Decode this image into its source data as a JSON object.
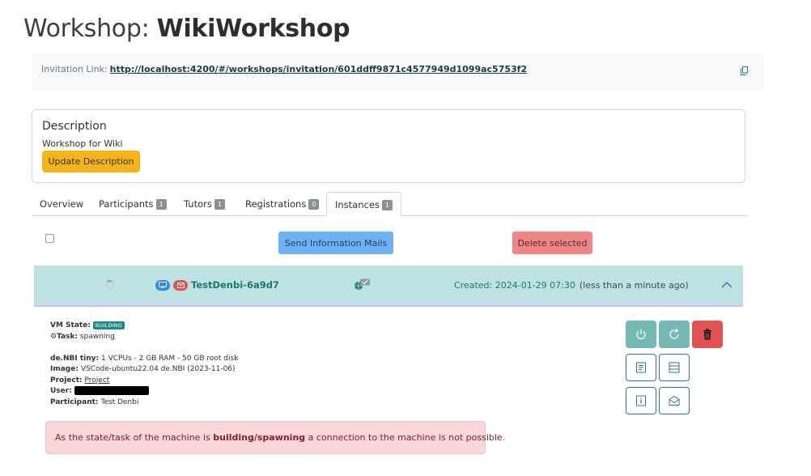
{
  "page": {
    "title_prefix": "Workshop: ",
    "title_name": "WikiWorkshop"
  },
  "invitation": {
    "label": "Invitation Link:",
    "url": "http://localhost:4200/#/workshops/invitation/601ddff9871c4577949d1099ac5753f2",
    "copy_icon": "copy-icon"
  },
  "description": {
    "heading": "Description",
    "text": "Workshop for Wiki",
    "update_button": "Update Description"
  },
  "tabs": [
    {
      "label": "Overview",
      "badge": ""
    },
    {
      "label": "Participants",
      "badge": "1"
    },
    {
      "label": "Tutors",
      "badge": "1"
    },
    {
      "label": "Registrations",
      "badge": "0"
    },
    {
      "label": "Instances",
      "badge": "1",
      "active": true
    }
  ],
  "actions": {
    "send_mails": "Send Information Mails",
    "delete_selected": "Delete selected"
  },
  "instance": {
    "name": "TestDenbi-6a9d7",
    "created": "Created: 2024-01-29 07:30",
    "ago": "(less than a minute ago)",
    "vm_state_label": "VM State:",
    "vm_state": "BUILDING",
    "task_label": "Task:",
    "task": "spawning",
    "flavor_label": "de.NBI tiny:",
    "flavor": "1 VCPUs - 2 GB RAM - 50 GB root disk",
    "image_label": "Image:",
    "image": "VSCode-ubuntu22.04 de.NBI (2023-11-06)",
    "project_label": "Project:",
    "project": "Project",
    "user_label": "User:",
    "participant_label": "Participant:",
    "participant": "Test Denbi",
    "alert_before": "As the state/task of the machine is ",
    "alert_bold": "building/spawning",
    "alert_after": " a connection to the machine is not possible."
  },
  "colors": {
    "instance_bg": "#bee1e3",
    "teal": "#1d7674",
    "warning": "#f4b41a",
    "danger": "#e15353",
    "info": "#6fb1f6"
  }
}
